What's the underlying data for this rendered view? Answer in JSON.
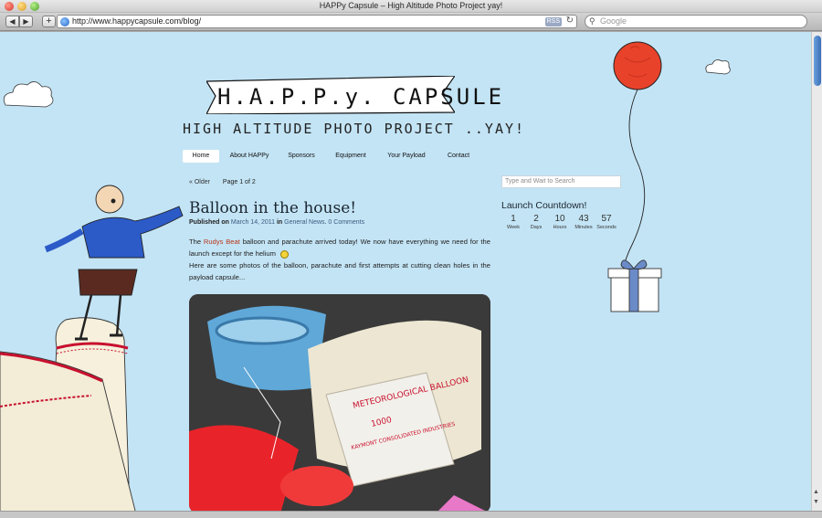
{
  "window": {
    "title": "HAPPy Capsule – High Altitude Photo Project yay!"
  },
  "toolbar": {
    "back": "◀",
    "forward": "▶",
    "add": "+",
    "url": "http://www.happycapsule.com/blog/",
    "rss": "RSS",
    "reload": "↻",
    "search_placeholder": "Google"
  },
  "header": {
    "logo_text": "H.A.P.P.y. CAPSULE",
    "tagline": "HIGH ALTITUDE PHOTO PROJECT ..YAY!"
  },
  "nav": {
    "items": [
      {
        "label": "Home"
      },
      {
        "label": "About HAPPy"
      },
      {
        "label": "Sponsors"
      },
      {
        "label": "Equipment"
      },
      {
        "label": "Your Payload"
      },
      {
        "label": "Contact"
      }
    ]
  },
  "pager": {
    "older": "« Older",
    "page_info": "Page 1 of 2"
  },
  "post": {
    "title": "Balloon in the house!",
    "meta_prefix": "Published on",
    "date": "March 14, 2011",
    "meta_in": "in",
    "category": "General News",
    "comments": "0 Comments",
    "p1_before": "The",
    "p1_link": "Rudys Beat",
    "p1_after": "balloon and parachute arrived today!  We now have everything we need for the launch except for the helium",
    "p2": "Here are some photos of the balloon, parachute and first attempts at cutting clean holes in the payload capsule..."
  },
  "sidebar": {
    "search_placeholder": "Type and Wait to Search",
    "countdown_title": "Launch Countdown!",
    "countdown": [
      {
        "value": "1",
        "label": "Week"
      },
      {
        "value": "2",
        "label": "Days"
      },
      {
        "value": "10",
        "label": "Hours"
      },
      {
        "value": "43",
        "label": "Minutes"
      },
      {
        "value": "57",
        "label": "Seconds"
      }
    ]
  },
  "photo": {
    "label_lines": [
      "METEOROLOGICAL BALLOON",
      "1000",
      "KAYMONT CONSOLIDATED INDUSTRIES"
    ]
  },
  "colors": {
    "page_bg": "#c3e4f5",
    "link": "#3a5c80",
    "rudy_link": "#b8361c",
    "balloon": "#e8422a"
  }
}
